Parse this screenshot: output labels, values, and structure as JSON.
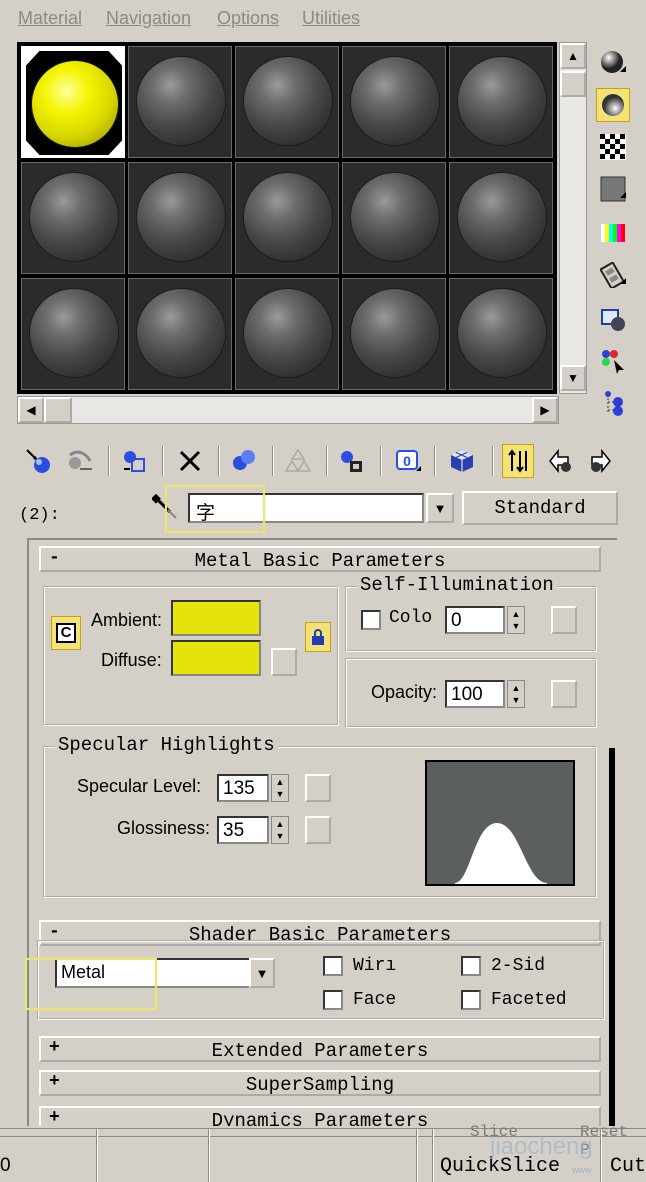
{
  "menu": [
    "Material",
    "Navigation",
    "Options",
    "Utilities"
  ],
  "toolbar": {
    "slot_label": "(2):",
    "material_name": "字",
    "material_type": "Standard"
  },
  "metal_basic": {
    "title": "Metal Basic Parameters",
    "collapse_sign": "-",
    "ambient_label": "Ambient:",
    "diffuse_label": "Diffuse:",
    "lock_toggle": "C",
    "ambient_color": "#e4e40a",
    "diffuse_color": "#e4e40a",
    "self_illum": {
      "title": "Self-Illumination",
      "color_label": "Colo",
      "value": "0"
    },
    "opacity_label": "Opacity:",
    "opacity_value": "100",
    "specular": {
      "title": "Specular Highlights",
      "level_label": "Specular Level:",
      "level_value": "135",
      "gloss_label": "Glossiness:",
      "gloss_value": "35"
    }
  },
  "shader_basic": {
    "title": "Shader Basic Parameters",
    "collapse_sign": "-",
    "shader": "Metal",
    "wire": "Wirı",
    "two_sided": "2-Sid",
    "face_map": "Face",
    "faceted": "Faceted"
  },
  "extended": {
    "title": "Extended Parameters",
    "sign": "+"
  },
  "supersampling": {
    "title": "SuperSampling",
    "sign": "+"
  },
  "dynamics": {
    "title": "Dynamics Parameters",
    "sign": "+"
  },
  "footer": {
    "left_value": "0",
    "partial_top": "Slice",
    "partial_top2": "Reset P",
    "quickslice": "QuickSlice",
    "cut": "Cut",
    "watermark": "jiaocheng",
    "watermark_sub": "www"
  },
  "colors": {
    "highlight": "#ece867",
    "active_slot_yellow": "#f4f400"
  }
}
